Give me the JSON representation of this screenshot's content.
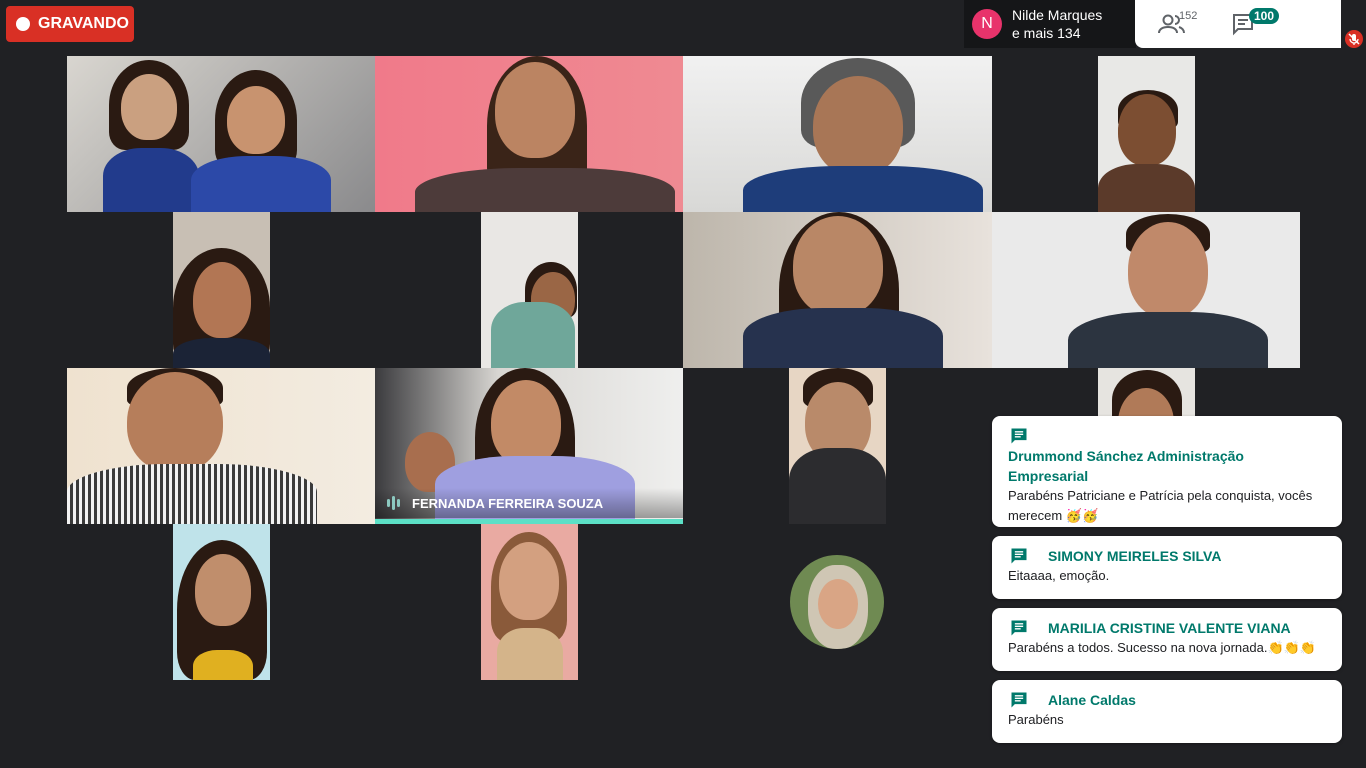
{
  "recording": {
    "label": "GRAVANDO"
  },
  "presenter": {
    "initial": "N",
    "line1": "Nilde Marques",
    "line2": "e mais 134"
  },
  "topbar": {
    "people_count": "152",
    "chat_badge": "100"
  },
  "tiles": [
    {
      "name": "FERNANDA FERREIRA SOUZA",
      "speaking": true
    }
  ],
  "chat": [
    {
      "name": "Drummond Sánchez Administração Empresarial",
      "message": "Parabéns Patriciane e Patrícia pela conquista, vocês merecem 🥳🥳"
    },
    {
      "name": "SIMONY MEIRELES SILVA",
      "message": "Eitaaaa, emoção."
    },
    {
      "name": "MARILIA CRISTINE VALENTE VIANA",
      "message": "Parabéns a todos. Sucesso na nova jornada.👏👏👏"
    },
    {
      "name": "Alane Caldas",
      "message": "Parabéns"
    }
  ],
  "colors": {
    "recording": "#d93025",
    "chat_accent": "#00796b",
    "speaking": "#5ce0c6",
    "avatar": "#e8336b"
  }
}
